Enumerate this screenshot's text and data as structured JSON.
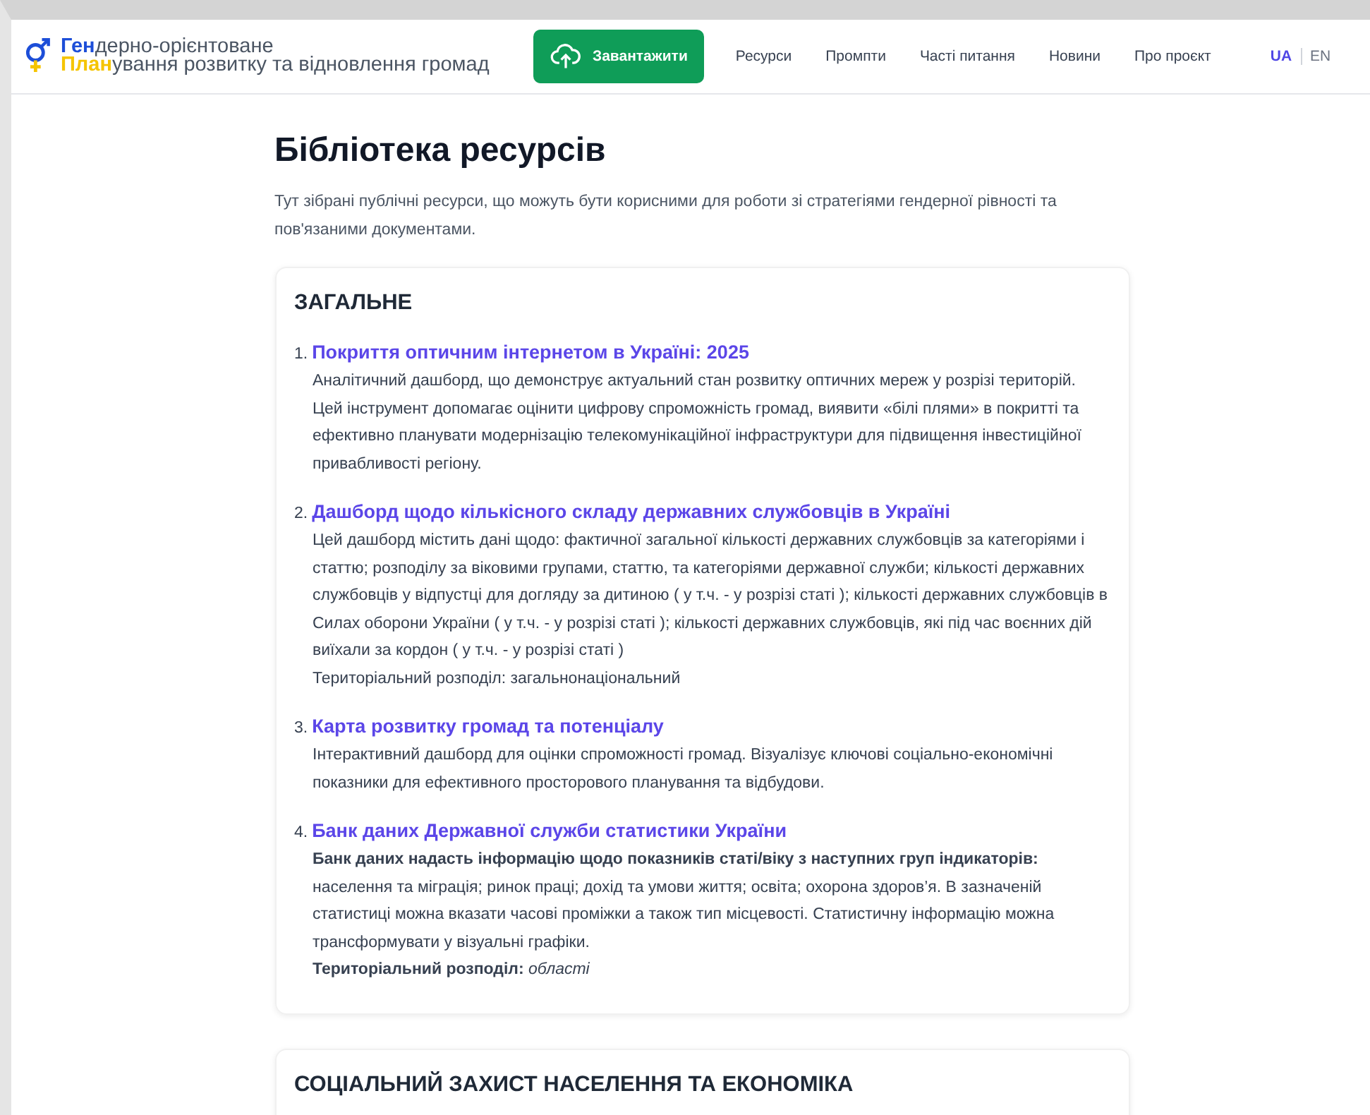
{
  "header": {
    "logo_lines": [
      {
        "accent": "Ген",
        "rest": "дерно-орієнтоване",
        "color": "#1d4ed8"
      },
      {
        "accent": "План",
        "rest": "ування розвитку та відновлення громад",
        "color": "#f5c400"
      }
    ],
    "upload_button": "Завантажити",
    "nav": [
      "Ресурси",
      "Промпти",
      "Часті питання",
      "Новини",
      "Про проєкт"
    ],
    "languages": [
      {
        "label": "UA",
        "selected": true
      },
      {
        "label": "EN",
        "selected": false
      }
    ]
  },
  "page": {
    "title": "Бібліотека ресурсів",
    "intro": "Тут зібрані публічні ресурси, що можуть бути корисними для роботи зі стратегіями гендерної рівності та пов'язаними документами."
  },
  "sections": [
    {
      "title": "ЗАГАЛЬНЕ",
      "items": [
        {
          "number": "1.",
          "title": "Покриття оптичним інтернетом в Україні: 2025",
          "description": "Аналітичний дашборд, що демонструє актуальний стан розвитку оптичних мереж у розрізі територій. Цей інструмент допомагає оцінити цифрову спроможність громад, виявити «білі плями» в покритті та ефективно планувати модернізацію телекомунікаційної інфраструктури для підвищення інвестиційної привабливості регіону."
        },
        {
          "number": "2.",
          "title": "Дашборд щодо кількісного складу державних службовців в Україні",
          "description": "Цей дашборд містить дані щодо: фактичної загальної кількості державних службовців за категоріями і статтю; розподілу за віковими групами, статтю, та категоріями державної служби; кількості державних службовців у відпустці для догляду за дитиною ( у т.ч. - у розрізі статі ); кількості державних службовців в Силах оборони України ( у т.ч. - у розрізі статі ); кількості державних службовців, які під час воєнних дій виїхали за кордон ( у т.ч. - у розрізі статі )",
          "extra": "Територіальний розподіл: загальнонаціональний"
        },
        {
          "number": "3.",
          "title": "Карта розвитку громад та потенціалу",
          "description": "Інтерактивний дашборд для оцінки спроможності громад. Візуалізує ключові соціально-економічні показники для ефективного просторового планування та відбудови."
        },
        {
          "number": "4.",
          "title": "Банк даних Державної служби статистики України",
          "description": "**Банк даних надасть інформацію щодо показників статі/віку з наступних груп індикаторів:** населення та міграція; ринок праці; дохід та умови життя; освіта; охорона здоров’я. В зазначеній статистиці можна вказати часові проміжки а також тип місцевості. Статистичну інформацію можна трансформувати у візуальні графіки.",
          "extra": "**Територіальний розподіл:** *області*"
        }
      ]
    },
    {
      "title": "СОЦІАЛЬНИЙ ЗАХИСТ НАСЕЛЕННЯ ТА ЕКОНОМІКА"
    }
  ]
}
